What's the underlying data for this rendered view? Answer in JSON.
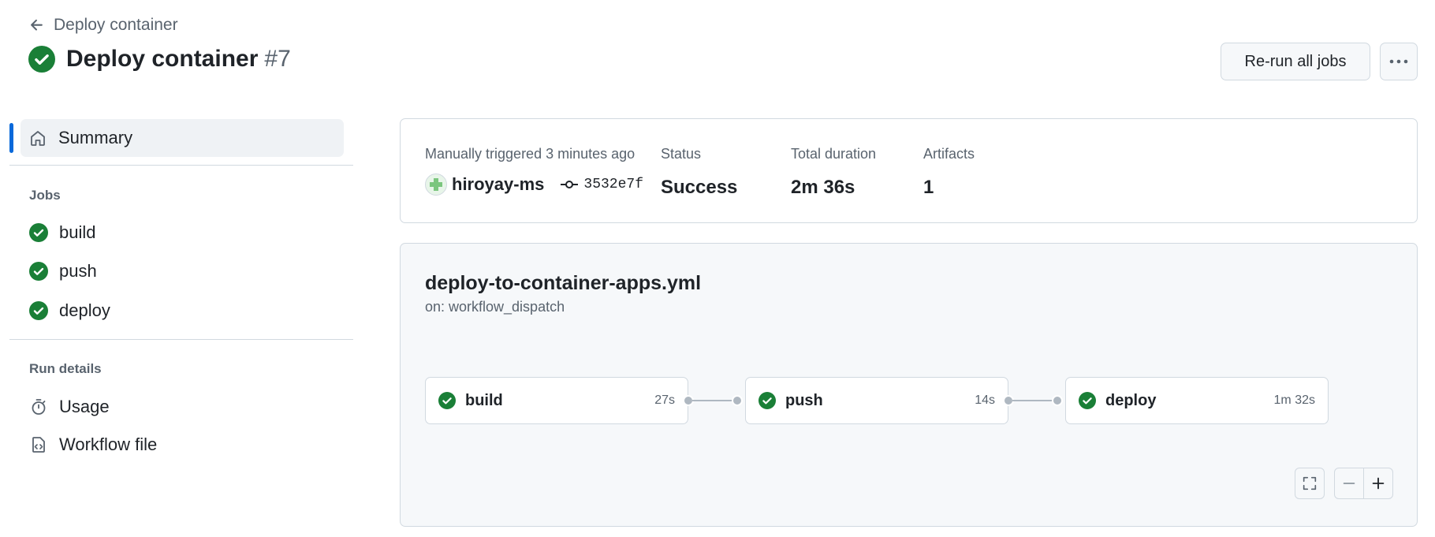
{
  "header": {
    "back_label": "Deploy container",
    "title": "Deploy container",
    "run_number": "#7",
    "rerun_label": "Re-run all jobs"
  },
  "sidebar": {
    "summary_label": "Summary",
    "jobs_heading": "Jobs",
    "jobs": [
      {
        "label": "build"
      },
      {
        "label": "push"
      },
      {
        "label": "deploy"
      }
    ],
    "run_details_heading": "Run details",
    "details": [
      {
        "label": "Usage",
        "icon": "stopwatch-icon"
      },
      {
        "label": "Workflow file",
        "icon": "file-code-icon"
      }
    ]
  },
  "info": {
    "trigger_label": "Manually triggered 3 minutes ago",
    "actor": "hiroyay-ms",
    "commit": "3532e7f",
    "status_label": "Status",
    "status_value": "Success",
    "duration_label": "Total duration",
    "duration_value": "2m 36s",
    "artifacts_label": "Artifacts",
    "artifacts_value": "1"
  },
  "graph": {
    "workflow_file": "deploy-to-container-apps.yml",
    "trigger": "on: workflow_dispatch",
    "jobs": [
      {
        "name": "build",
        "duration": "27s"
      },
      {
        "name": "push",
        "duration": "14s"
      },
      {
        "name": "deploy",
        "duration": "1m 32s"
      }
    ]
  },
  "colors": {
    "success": "#1a7f37",
    "accent": "#0969da"
  }
}
